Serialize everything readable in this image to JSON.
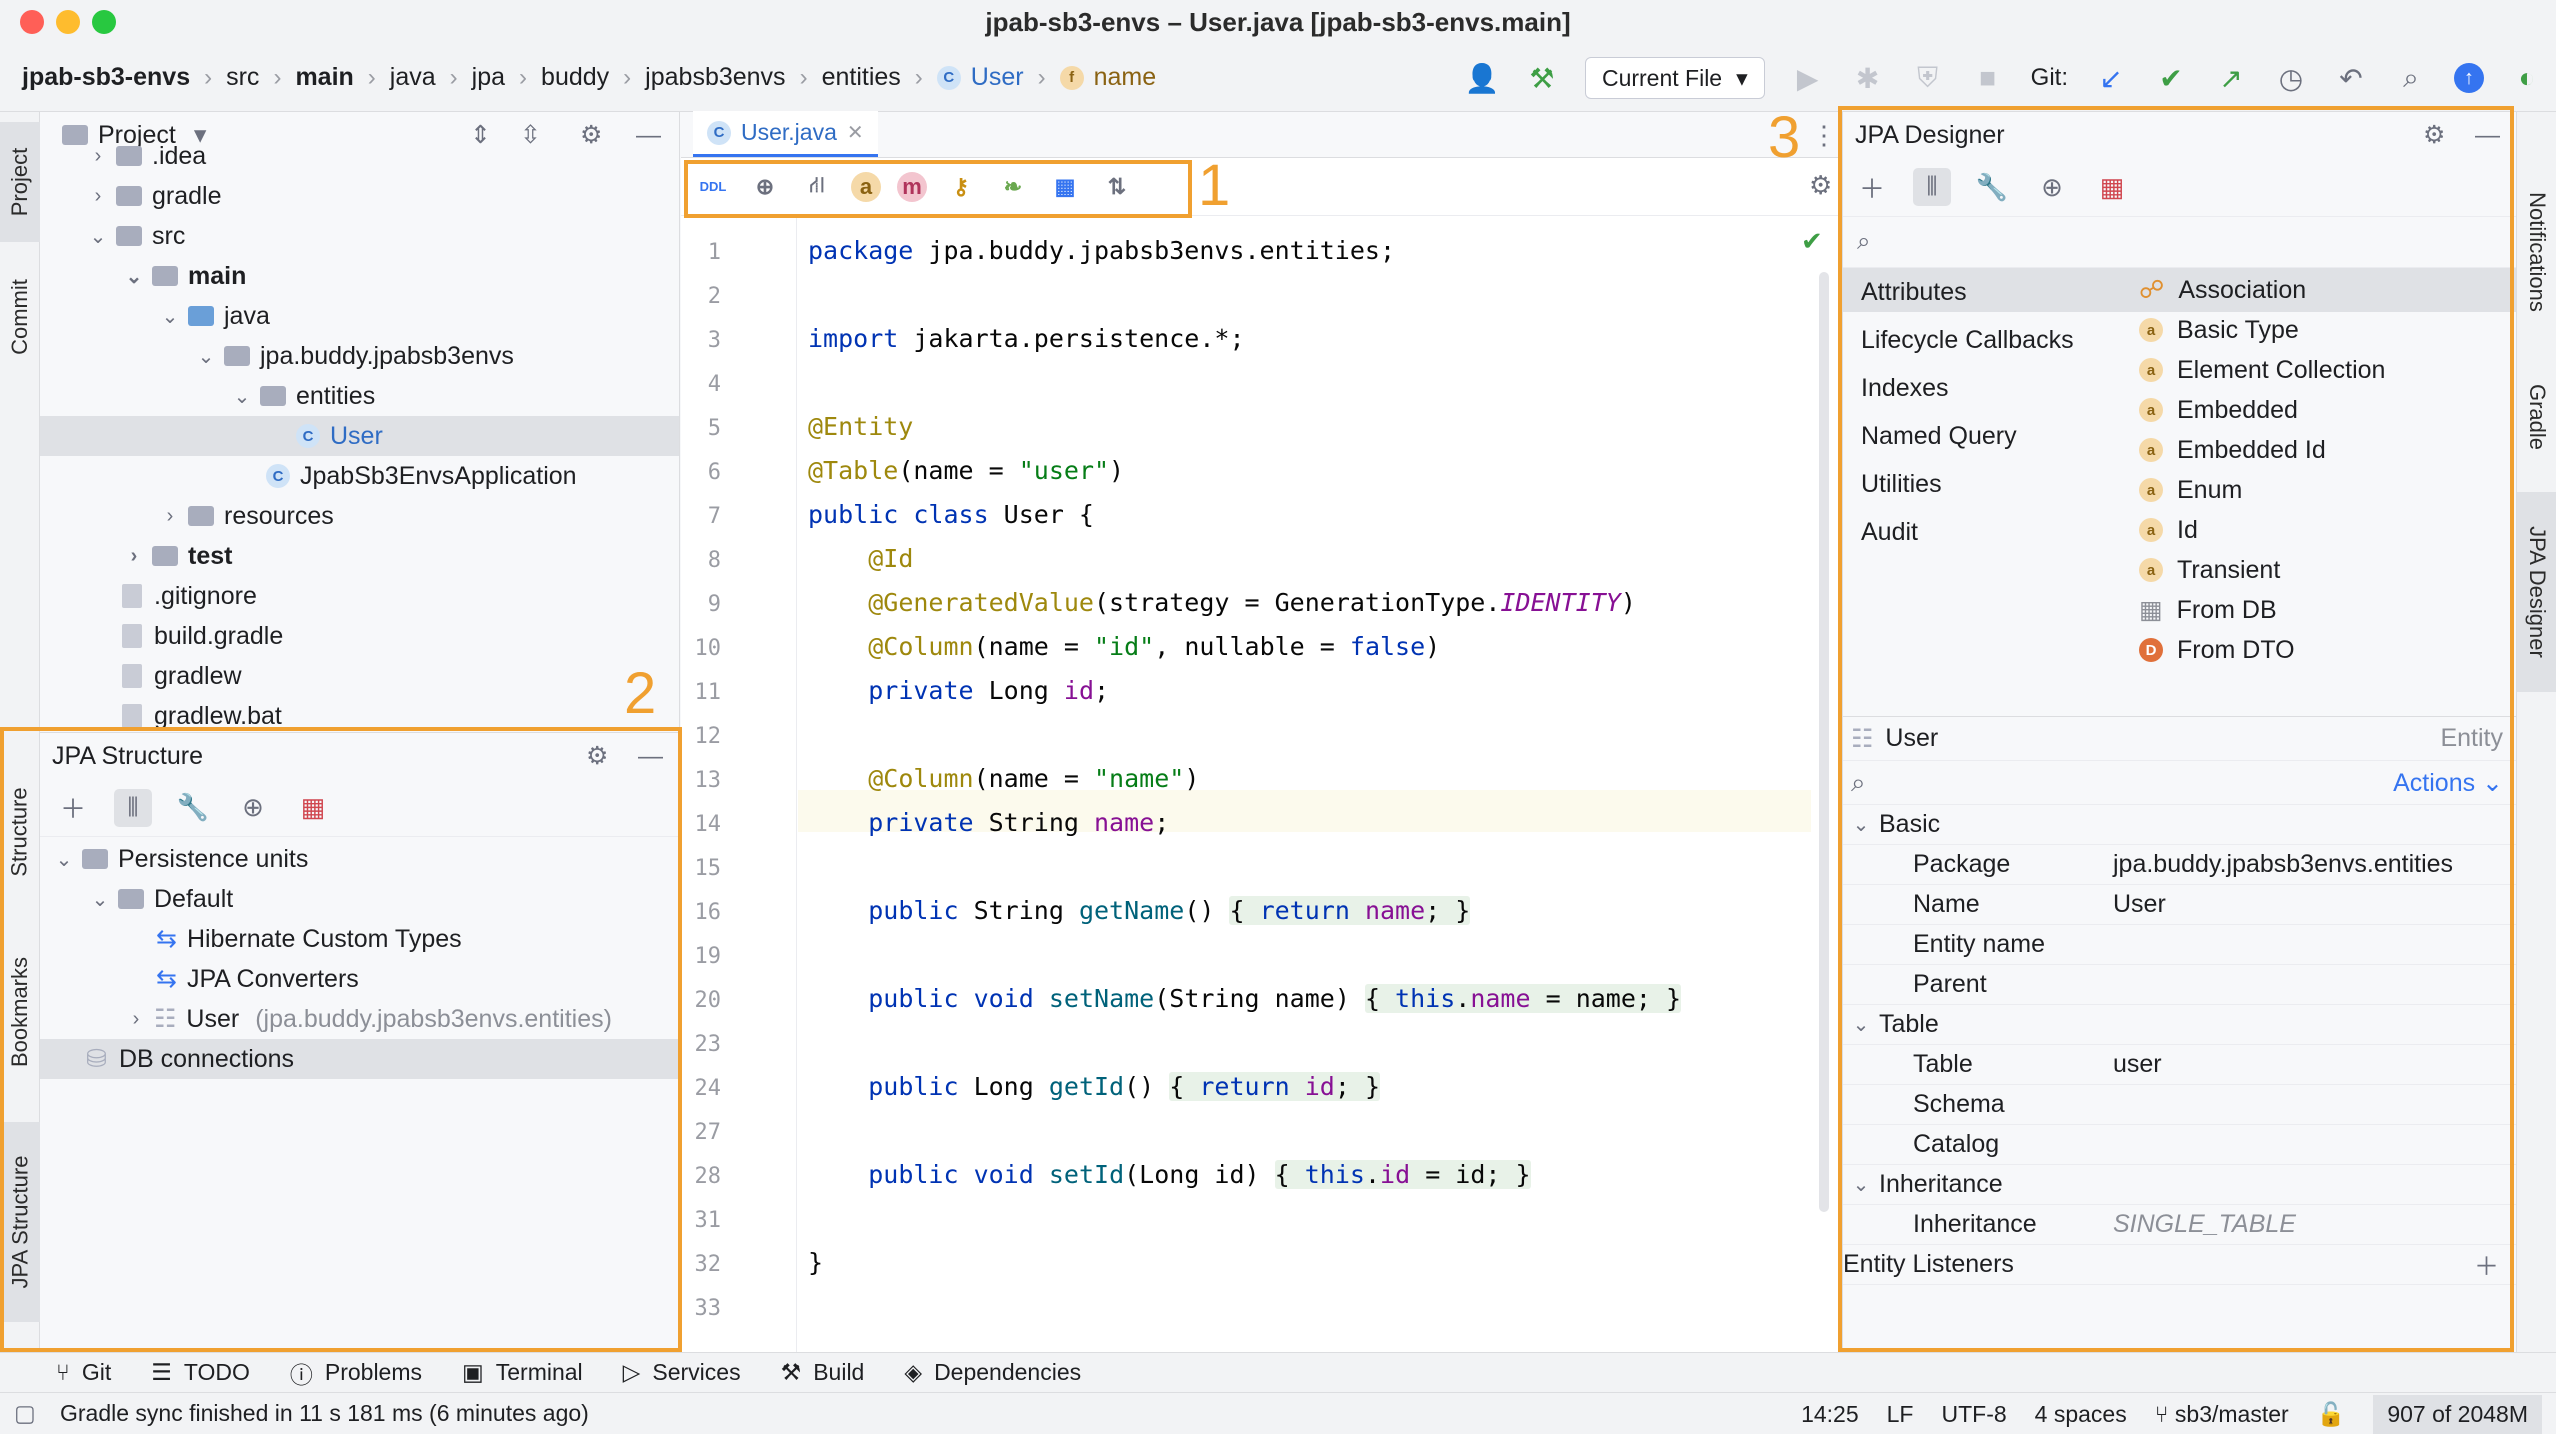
{
  "window": {
    "title": "jpab-sb3-envs – User.java [jpab-sb3-envs.main]"
  },
  "breadcrumb": [
    "jpab-sb3-envs",
    "src",
    "main",
    "java",
    "jpa",
    "buddy",
    "jpabsb3envs",
    "entities",
    "User",
    "name"
  ],
  "toolbar": {
    "run_config": "Current File",
    "git_label": "Git:"
  },
  "project": {
    "title": "Project",
    "tree": [
      {
        "label": ".idea",
        "indent": 1
      },
      {
        "label": "gradle",
        "indent": 1
      },
      {
        "label": "src",
        "indent": 1
      },
      {
        "label": "main",
        "indent": 2
      },
      {
        "label": "java",
        "indent": 3
      },
      {
        "label": "jpa.buddy.jpabsb3envs",
        "indent": 4
      },
      {
        "label": "entities",
        "indent": 5
      },
      {
        "label": "User",
        "indent": 6
      },
      {
        "label": "JpabSb3EnvsApplication",
        "indent": 5
      },
      {
        "label": "resources",
        "indent": 3
      },
      {
        "label": "test",
        "indent": 2
      },
      {
        "label": ".gitignore",
        "indent": 1
      },
      {
        "label": "build.gradle",
        "indent": 1
      },
      {
        "label": "gradlew",
        "indent": 1
      },
      {
        "label": "gradlew.bat",
        "indent": 1
      }
    ]
  },
  "jpa_structure": {
    "title": "JPA Structure",
    "tree": [
      {
        "label": "Persistence units"
      },
      {
        "label": "Default"
      },
      {
        "label": "Hibernate Custom Types"
      },
      {
        "label": "JPA Converters"
      },
      {
        "label": "User",
        "hint": "(jpa.buddy.jpabsb3envs.entities)"
      },
      {
        "label": "DB connections"
      }
    ]
  },
  "editor": {
    "tab": "User.java",
    "line_numbers": [
      "1",
      "2",
      "3",
      "4",
      "5",
      "6",
      "7",
      "8",
      "9",
      "10",
      "11",
      "12",
      "13",
      "14",
      "15",
      "16",
      "19",
      "20",
      "23",
      "24",
      "27",
      "28",
      "31",
      "32",
      "33"
    ]
  },
  "designer": {
    "title": "JPA Designer",
    "categories": [
      "Attributes",
      "Lifecycle Callbacks",
      "Indexes",
      "Named Query",
      "Utilities",
      "Audit"
    ],
    "options": [
      "Association",
      "Basic Type",
      "Element Collection",
      "Embedded",
      "Embedded Id",
      "Enum",
      "Id",
      "Transient",
      "From DB",
      "From DTO"
    ],
    "entity": {
      "name": "User",
      "kind": "Entity",
      "actions": "Actions"
    },
    "groups": {
      "basic": "Basic",
      "table": "Table",
      "inheritance": "Inheritance",
      "listeners": "Entity Listeners"
    },
    "props": {
      "package_k": "Package",
      "package_v": "jpa.buddy.jpabsb3envs.entities",
      "name_k": "Name",
      "name_v": "User",
      "entity_name_k": "Entity name",
      "parent_k": "Parent",
      "table_k": "Table",
      "table_v": "user",
      "schema_k": "Schema",
      "catalog_k": "Catalog",
      "inheritance_k": "Inheritance",
      "inheritance_v": "SINGLE_TABLE"
    }
  },
  "left_tabs": [
    "Project",
    "Commit",
    "Structure",
    "Bookmarks",
    "JPA Structure"
  ],
  "right_tabs": [
    "Notifications",
    "Gradle",
    "JPA Designer"
  ],
  "tool_windows": [
    "Git",
    "TODO",
    "Problems",
    "Terminal",
    "Services",
    "Build",
    "Dependencies"
  ],
  "status": {
    "message": "Gradle sync finished in 11 s 181 ms (6 minutes ago)",
    "position": "14:25",
    "line_sep": "LF",
    "encoding": "UTF-8",
    "indent": "4 spaces",
    "branch": "sb3/master",
    "memory": "907 of 2048M"
  },
  "callouts": [
    "1",
    "2",
    "3"
  ]
}
